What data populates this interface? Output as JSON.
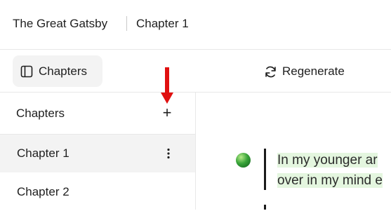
{
  "header": {
    "book_title": "The Great Gatsby",
    "chapter_title": "Chapter 1"
  },
  "toolbar": {
    "chapters_label": "Chapters",
    "chapters_icon": "sidebar-panel-icon",
    "regenerate_label": "Regenerate",
    "regenerate_icon": "refresh-icon"
  },
  "sidebar": {
    "title": "Chapters",
    "add_symbol": "+",
    "items": [
      {
        "label": "Chapter 1",
        "active": true
      },
      {
        "label": "Chapter 2",
        "active": false
      }
    ]
  },
  "content": {
    "line1": "In my younger ar",
    "line2": "over in my mind e",
    "highlight_color": "#e4f6df"
  },
  "annotation": {
    "arrow_color": "#e01010"
  }
}
